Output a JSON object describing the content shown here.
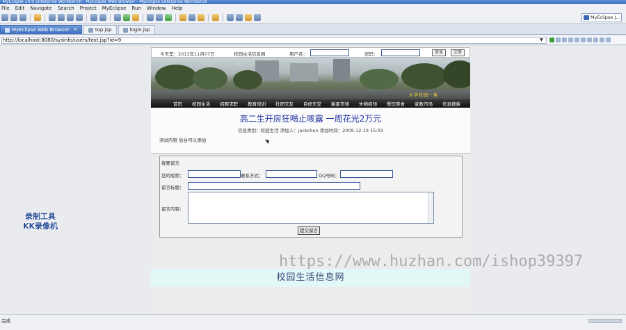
{
  "window": {
    "title": "MyEclipse 10.0 Enterprise Workbench - MyEclipse Web Browser - MyEclipse Enterprise Workbench"
  },
  "menu": [
    "File",
    "Edit",
    "Navigate",
    "Search",
    "Project",
    "MyEclipse",
    "Run",
    "Window",
    "Help"
  ],
  "perspective": "MyEclipse J...",
  "tabs": [
    {
      "label": "MyEclipse Web Browser",
      "close": "✕"
    },
    {
      "label": "top.jsp"
    },
    {
      "label": "login.jsp"
    }
  ],
  "browser": {
    "url": "http://localhost:8080/sysInfo/users/text.jsp?id=9"
  },
  "site": {
    "topinfo": {
      "date": "今天是：2013年11月07日",
      "school": "校园生活信息网",
      "username_label": "用户名：",
      "password_label": "密码：",
      "login": "登录",
      "register": "注册"
    },
    "banner_caption": "大学校园一角",
    "nav": [
      "首页",
      "校园生活",
      "招聘求职",
      "教育培训",
      "社团交友",
      "自修天堂",
      "跳蚤市场",
      "失物招领",
      "餐饮美食",
      "家教市场",
      "信息搜索"
    ],
    "article": {
      "title": "高二生开房狂喝止咳露  一周花光2万元",
      "meta": "信息类别：校园生活  添加人：jackchen  添加时间：2009-12-19 15:03",
      "body": "测试内容  后台可以添加"
    },
    "comment_form": {
      "title": "我要留言",
      "nickname_label": "您的昵称：",
      "contact_label": "联系方式：",
      "qq_label": "QQ号码：",
      "subject_label": "留言标题：",
      "content_label": "留言内容：",
      "submit": "提交留言"
    },
    "footer": "校园生活信息网"
  },
  "overlays": {
    "recorder_line1": "录制工具",
    "recorder_line2": "KK录像机",
    "site_watermark": "https://www.huzhan.com/ishop39397"
  },
  "status": {
    "text": "完成"
  }
}
